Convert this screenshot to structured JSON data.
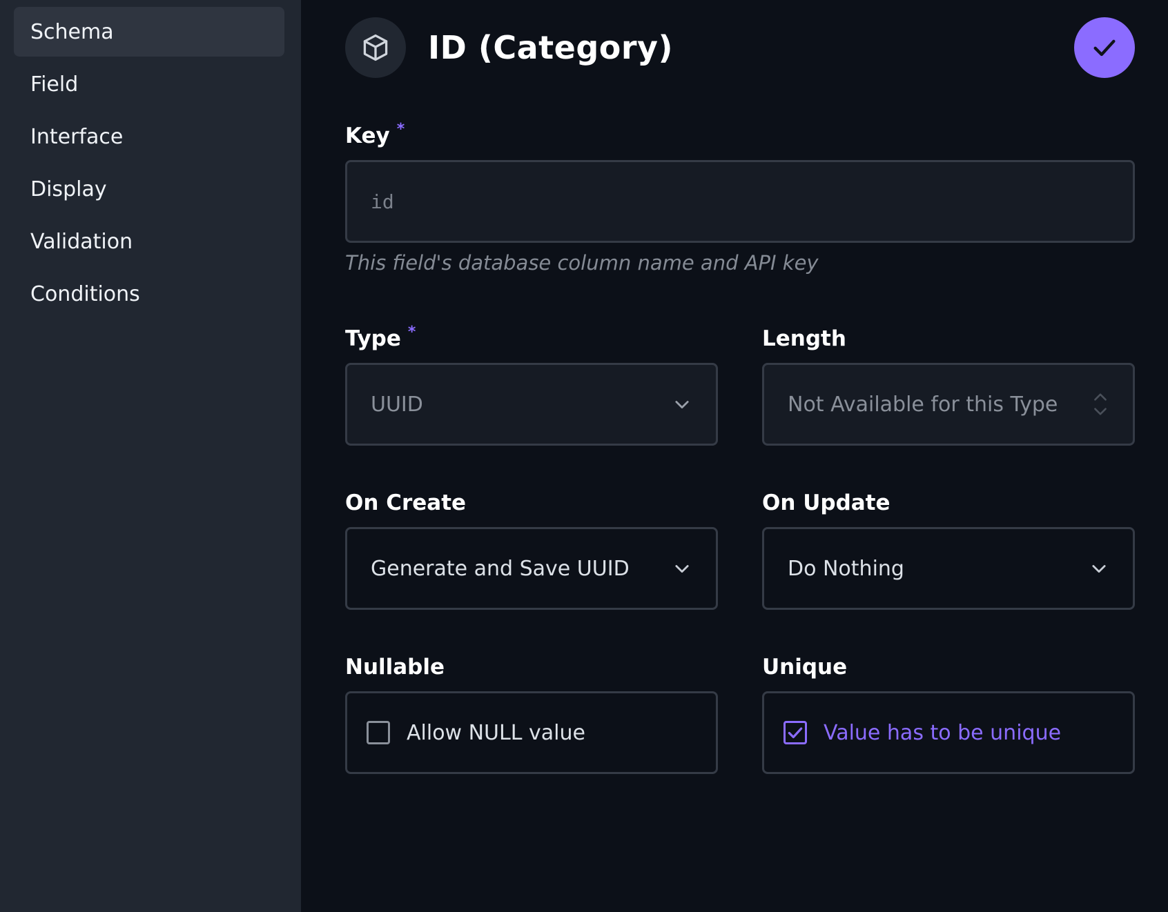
{
  "sidebar": {
    "items": [
      {
        "label": "Schema",
        "active": true
      },
      {
        "label": "Field"
      },
      {
        "label": "Interface"
      },
      {
        "label": "Display"
      },
      {
        "label": "Validation"
      },
      {
        "label": "Conditions"
      }
    ]
  },
  "header": {
    "icon": "cube-icon",
    "title": "ID (Category)",
    "save_icon": "check-icon"
  },
  "form": {
    "key": {
      "label": "Key",
      "required_mark": "*",
      "value": "id",
      "hint": "This field's database column name and API key"
    },
    "type": {
      "label": "Type",
      "required_mark": "*",
      "value": "UUID"
    },
    "length": {
      "label": "Length",
      "placeholder": "Not Available for this Type"
    },
    "on_create": {
      "label": "On Create",
      "value": "Generate and Save UUID"
    },
    "on_update": {
      "label": "On Update",
      "value": "Do Nothing"
    },
    "nullable": {
      "label": "Nullable",
      "checkbox_label": "Allow NULL value",
      "checked": false
    },
    "unique": {
      "label": "Unique",
      "checkbox_label": "Value has to be unique",
      "checked": true
    }
  },
  "colors": {
    "accent": "#8b6cff",
    "sidebar_bg": "#212731",
    "main_bg": "#0c1018"
  }
}
